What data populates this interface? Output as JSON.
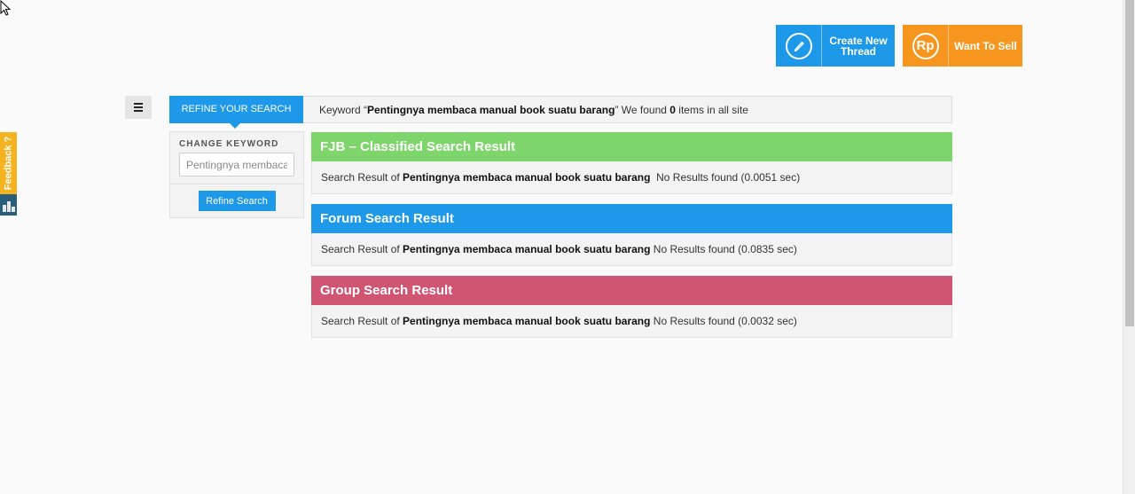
{
  "header": {
    "create_thread_label": "Create New Thread",
    "want_to_sell_label": "Want To Sell",
    "sell_icon_text": "Rp"
  },
  "feedback": {
    "label": "Feedback ?"
  },
  "search_bar": {
    "refine_tab_label": "REFINE YOUR SEARCH",
    "keyword_prefix": "Keyword “",
    "keyword": "Pentingnya membaca manual book suatu barang",
    "keyword_suffix": "” We found ",
    "count": "0",
    "count_suffix": " items in all site"
  },
  "left_panel": {
    "change_keyword_label": "CHANGE KEYWORD",
    "keyword_value": "Pentingnya membaca manual book suatu barang",
    "refine_button_label": "Refine Search"
  },
  "results": {
    "fjb": {
      "title": "FJB – Classified Search Result",
      "prefix": "Search Result of ",
      "keyword": "Pentingnya membaca manual book suatu barang",
      "status": "  No Results found (0.0051 sec)"
    },
    "forum": {
      "title": "Forum Search Result",
      "prefix": "Search Result of ",
      "keyword": "Pentingnya membaca manual book suatu barang",
      "status": " No Results found (0.0835 sec)"
    },
    "group": {
      "title": "Group Search Result",
      "prefix": "Search Result of ",
      "keyword": "Pentingnya membaca manual book suatu barang",
      "status": " No Results found (0.0032 sec)"
    }
  },
  "colors": {
    "blue": "#1e98e8",
    "orange": "#f7961e",
    "green": "#7ed56b",
    "pink": "#d05572",
    "feedback": "#f5b31f"
  },
  "icons": [
    "pencil-icon",
    "rupiah-icon",
    "hamburger-icon",
    "feedback-icon",
    "cursor-icon"
  ]
}
